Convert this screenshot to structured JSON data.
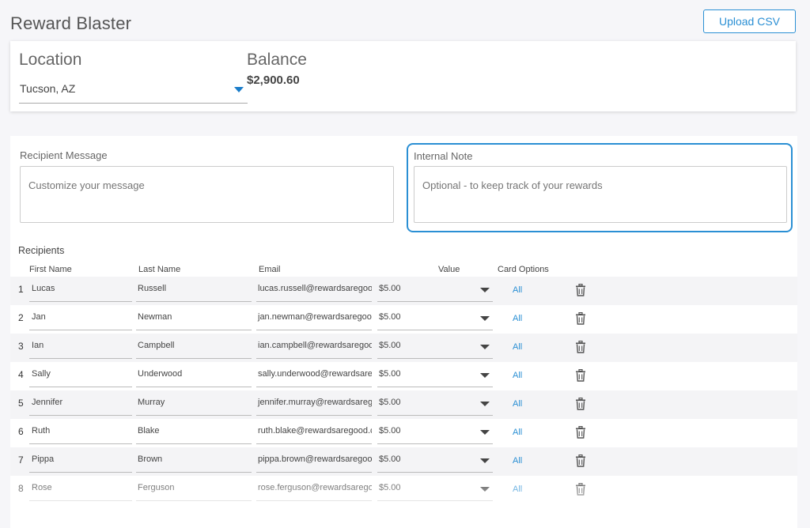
{
  "app": {
    "title": "Reward Blaster",
    "upload_label": "Upload CSV"
  },
  "location": {
    "label": "Location",
    "value": "Tucson, AZ"
  },
  "balance": {
    "label": "Balance",
    "value": "$2,900.60"
  },
  "message": {
    "label": "Recipient Message",
    "placeholder": "Customize your message"
  },
  "note": {
    "label": "Internal Note",
    "placeholder": "Optional - to keep track of your rewards"
  },
  "recipients": {
    "label": "Recipients",
    "columns": {
      "first": "First Name",
      "last": "Last Name",
      "email": "Email",
      "value": "Value",
      "card": "Card Options"
    },
    "rows": [
      {
        "num": "1",
        "first": "Lucas",
        "last": "Russell",
        "email": "lucas.russell@rewardsaregood.com",
        "value": "$5.00",
        "card": "All"
      },
      {
        "num": "2",
        "first": "Jan",
        "last": "Newman",
        "email": "jan.newman@rewardsaregood.com",
        "value": "$5.00",
        "card": "All"
      },
      {
        "num": "3",
        "first": "Ian",
        "last": "Campbell",
        "email": "ian.campbell@rewardsaregood.com",
        "value": "$5.00",
        "card": "All"
      },
      {
        "num": "4",
        "first": "Sally",
        "last": "Underwood",
        "email": "sally.underwood@rewardsaregood.com",
        "value": "$5.00",
        "card": "All"
      },
      {
        "num": "5",
        "first": "Jennifer",
        "last": "Murray",
        "email": "jennifer.murray@rewardsaregood.com",
        "value": "$5.00",
        "card": "All"
      },
      {
        "num": "6",
        "first": "Ruth",
        "last": "Blake",
        "email": "ruth.blake@rewardsaregood.com",
        "value": "$5.00",
        "card": "All"
      },
      {
        "num": "7",
        "first": "Pippa",
        "last": "Brown",
        "email": "pippa.brown@rewardsaregood.com",
        "value": "$5.00",
        "card": "All"
      },
      {
        "num": "8",
        "first": "Rose",
        "last": "Ferguson",
        "email": "rose.ferguson@rewardsaregood.com",
        "value": "$5.00",
        "card": "All"
      }
    ]
  },
  "colors": {
    "accent": "#2a8fd4",
    "row_shade": "#f4f4f6"
  },
  "icons": {
    "dropdown": "caret-down-icon",
    "delete": "trash-icon"
  }
}
